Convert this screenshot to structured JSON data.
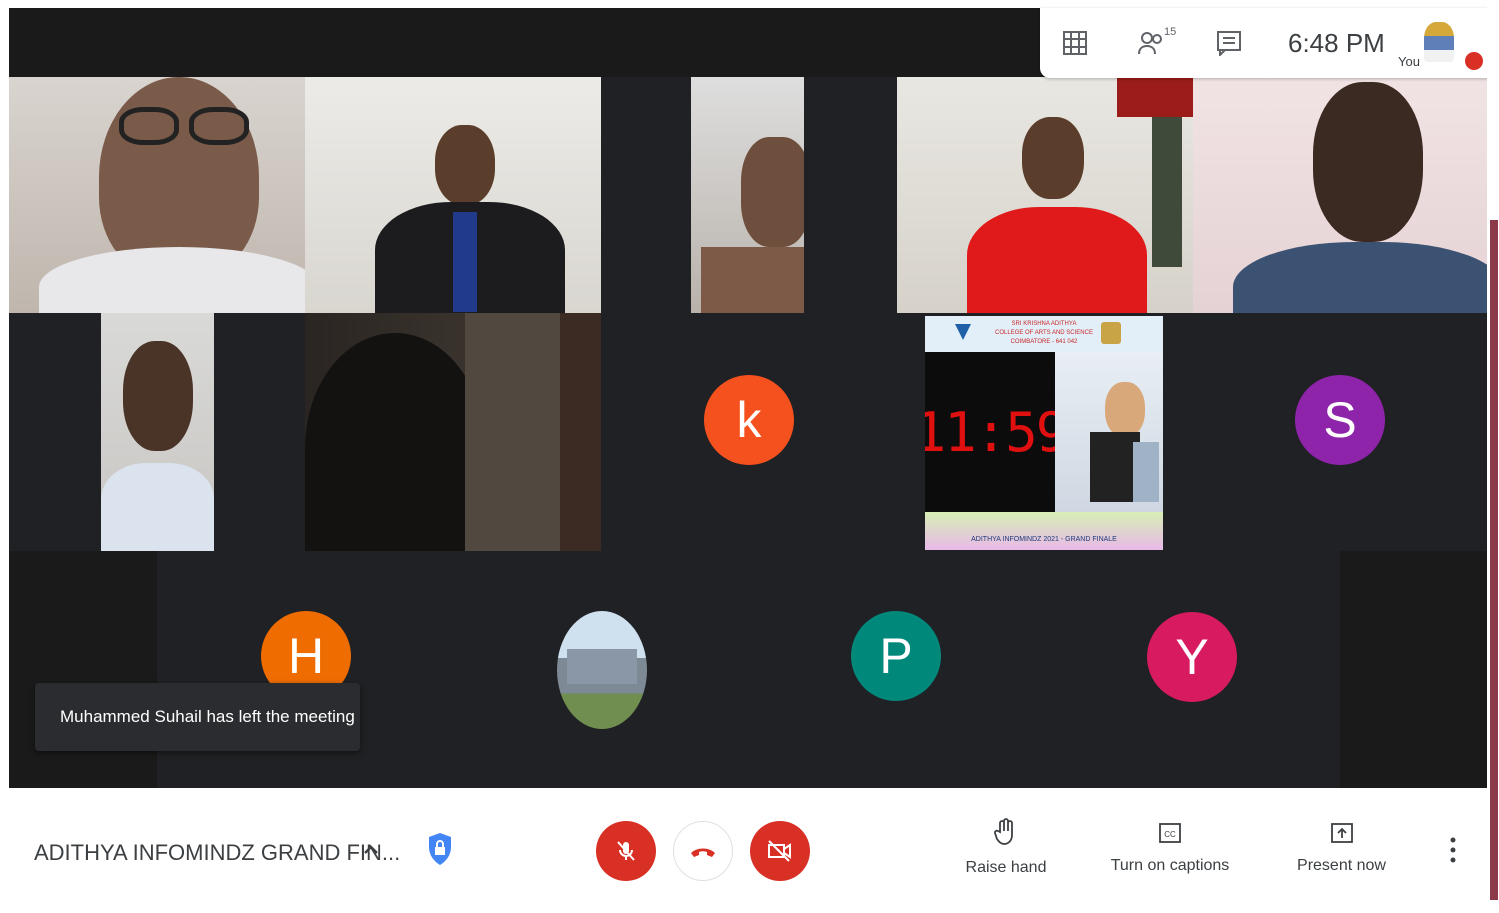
{
  "header": {
    "participants_count": "15",
    "time": "6:48 PM",
    "self_label": "You"
  },
  "tiles": {
    "k": {
      "initial": "k",
      "color": "#f4511e"
    },
    "s": {
      "initial": "S",
      "color": "#8e24aa"
    },
    "h": {
      "initial": "H",
      "color": "#ef6c00"
    },
    "p": {
      "initial": "P",
      "color": "#00897b"
    },
    "y": {
      "initial": "Y",
      "color": "#d81b60"
    }
  },
  "presentation": {
    "college_name": "SRI KRISHNA ADITHYA",
    "college_sub": "COLLEGE OF ARTS AND SCIENCE",
    "college_city": "COIMBATORE - 641 042",
    "timer": "11:59",
    "caption": "ADITHYA INFOMINDZ 2021 - GRAND FINALE"
  },
  "toast": {
    "message": "Muhammed Suhail has left the meeting"
  },
  "bottom": {
    "meeting_title": "ADITHYA INFOMINDZ GRAND FIN...",
    "raise_hand": "Raise hand",
    "captions": "Turn on captions",
    "present": "Present now"
  }
}
